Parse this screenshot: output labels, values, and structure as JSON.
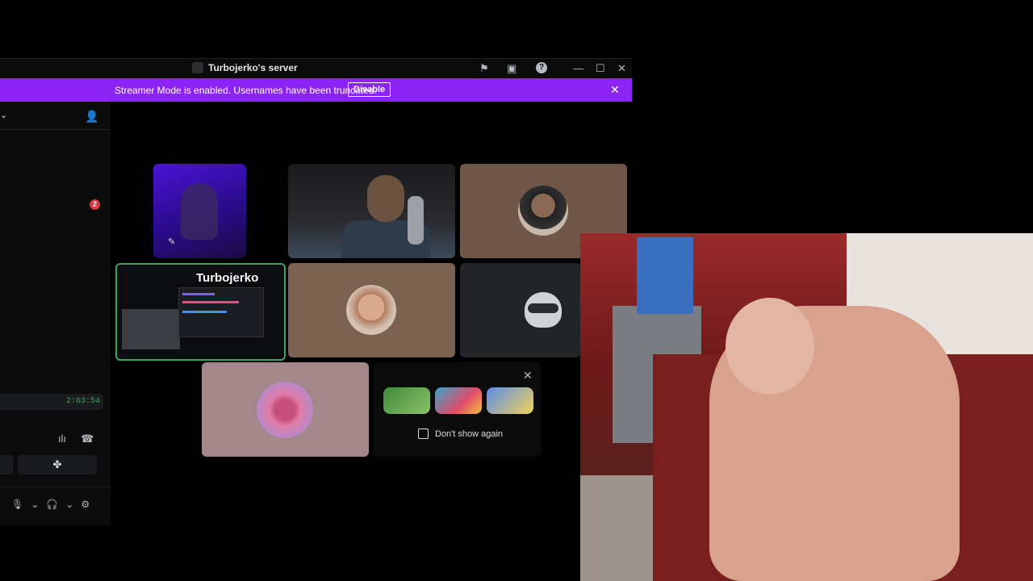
{
  "window": {
    "title": "Turbojerko's server",
    "controls": {
      "minimize": "—",
      "maximize": "☐",
      "close": "✕"
    },
    "toolbar_icons": [
      "flag-icon",
      "inbox-icon",
      "help-icon"
    ]
  },
  "banner": {
    "text": "Streamer Mode is enabled. Usernames have been truncated.",
    "button": "Disable",
    "close": "✕"
  },
  "sidebar": {
    "badge_count": "2",
    "call_timer": "2:03:54"
  },
  "stage": {
    "screenshare_user": "Turbojerko",
    "promo": {
      "close": "✕",
      "checkbox_label": "Don't show again"
    }
  },
  "colors": {
    "banner": "#8c25f4",
    "speaking_border": "#3ba55d",
    "badge": "#da373c"
  }
}
